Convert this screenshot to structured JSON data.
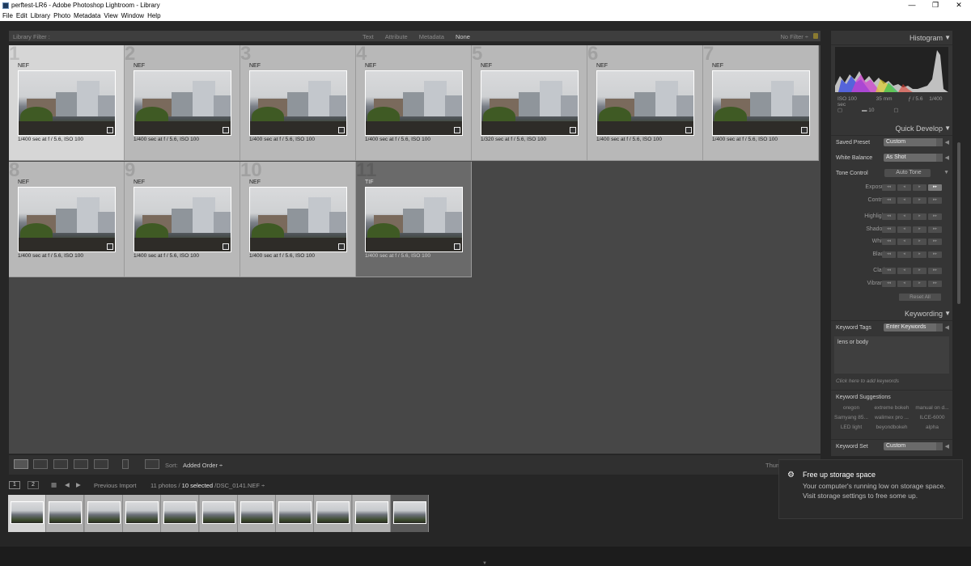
{
  "window": {
    "title": "perftest-LR6 - Adobe Photoshop Lightroom - Library",
    "minimize": "—",
    "maximize": "❐",
    "close": "✕"
  },
  "menu": [
    "File",
    "Edit",
    "Library",
    "Photo",
    "Metadata",
    "View",
    "Window",
    "Help"
  ],
  "filter": {
    "label": "Library Filter :",
    "tabs": [
      "Text",
      "Attribute",
      "Metadata",
      "None"
    ],
    "active": "None",
    "preset": "No Filter ÷"
  },
  "grid": [
    {
      "num": "1",
      "fmt": "NEF",
      "meta": "1/400 sec at f / 5.6, ISO 100",
      "state": "primary"
    },
    {
      "num": "2",
      "fmt": "NEF",
      "meta": "1/400 sec at f / 5.6, ISO 100",
      "state": "selected"
    },
    {
      "num": "3",
      "fmt": "NEF",
      "meta": "1/400 sec at f / 5.6, ISO 100",
      "state": "selected"
    },
    {
      "num": "4",
      "fmt": "NEF",
      "meta": "1/400 sec at f / 5.6, ISO 100",
      "state": "selected"
    },
    {
      "num": "5",
      "fmt": "NEF",
      "meta": "1/320 sec at f / 5.6, ISO 100",
      "state": "selected"
    },
    {
      "num": "6",
      "fmt": "NEF",
      "meta": "1/400 sec at f / 5.6, ISO 100",
      "state": "selected"
    },
    {
      "num": "7",
      "fmt": "NEF",
      "meta": "1/400 sec at f / 5.6, ISO 100",
      "state": "selected"
    },
    {
      "num": "8",
      "fmt": "NEF",
      "meta": "1/400 sec at f / 5.6, ISO 100",
      "state": "selected"
    },
    {
      "num": "9",
      "fmt": "NEF",
      "meta": "1/400 sec at f / 5.6, ISO 100",
      "state": "selected"
    },
    {
      "num": "10",
      "fmt": "NEF",
      "meta": "1/400 sec at f / 5.6, ISO 100",
      "state": "selected"
    },
    {
      "num": "11",
      "fmt": "TIF",
      "meta": "1/400 sec at f / 5.6, ISO 100",
      "state": "unselected"
    }
  ],
  "toolbar": {
    "sort_label": "Sort:",
    "sort_value": "Added Order ÷",
    "thumb_label": "Thum"
  },
  "histogram": {
    "title": "Histogram",
    "iso": "ISO 100",
    "focal": "35 mm",
    "aperture": "ƒ / 5.6",
    "shutter": "1/400 sec",
    "count": "10"
  },
  "quick_develop": {
    "title": "Quick Develop",
    "saved_preset_label": "Saved Preset",
    "saved_preset_value": "Custom",
    "white_balance_label": "White Balance",
    "white_balance_value": "As Shot",
    "tone_control_label": "Tone Control",
    "auto_tone": "Auto Tone",
    "adjustments": [
      "Exposure",
      "Contrast",
      "Highlights",
      "Shadows",
      "Whites",
      "Blacks",
      "Clarity",
      "Vibrance"
    ],
    "reset_all": "Reset All"
  },
  "keywording": {
    "title": "Keywording",
    "tags_label": "Keyword Tags",
    "tags_value": "Enter Keywords",
    "box_text": "lens or body",
    "hint": "Click here to add keywords",
    "suggestions_title": "Keyword Suggestions",
    "suggestions": [
      "oregon",
      "extreme bokeh",
      "manual on d...",
      "Samyang 85...",
      "walimex pro ...",
      "ILCE-6000",
      "LED light",
      "beyondbokeh",
      "alpha"
    ],
    "set_label": "Keyword Set",
    "set_value": "Custom"
  },
  "filmstrip": {
    "page1": "1",
    "page2": "2",
    "source": "Previous Import",
    "count": "11 photos /",
    "selected": "10 selected",
    "file": "/DSC_0141.NEF ÷"
  },
  "toast": {
    "title": "Free up storage space",
    "body": "Your computer's running low on storage space. Visit storage settings to free some up."
  }
}
